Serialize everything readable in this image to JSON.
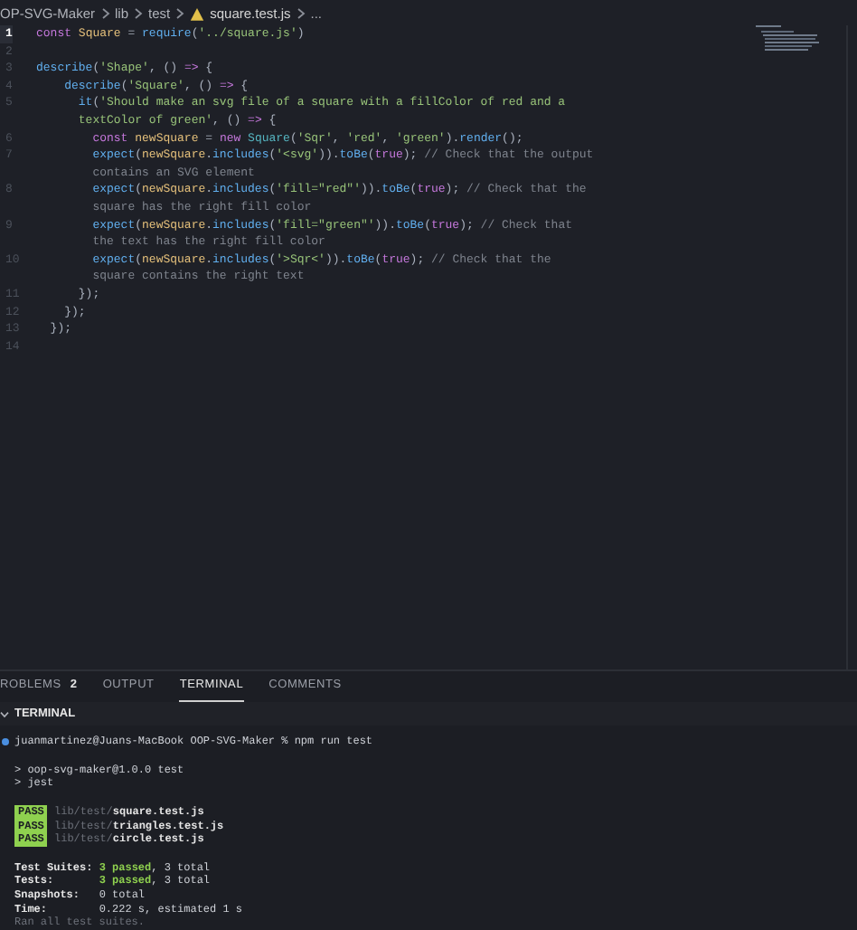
{
  "breadcrumb": [
    {
      "kind": "folder",
      "text": "OP-SVG-Maker"
    },
    {
      "kind": "folder",
      "text": "lib"
    },
    {
      "kind": "folder",
      "text": "test"
    },
    {
      "kind": "file",
      "text": "square.test.js"
    },
    {
      "kind": "more",
      "text": "..."
    }
  ],
  "code": [
    {
      "number": "1",
      "current": true,
      "tokens": [
        {
          "kind": "kw",
          "text": "const"
        },
        {
          "kind": "var",
          "text": " Square"
        },
        {
          "kind": "p",
          "text": " = "
        },
        {
          "kind": "fn",
          "text": "require"
        },
        {
          "kind": "p",
          "text": "("
        },
        {
          "kind": "str",
          "text": "'../square.js'"
        },
        {
          "kind": "p",
          "text": ")"
        }
      ]
    },
    {
      "number": "2",
      "current": false
    },
    {
      "number": "3",
      "current": false,
      "tokens": [
        {
          "kind": "fn",
          "text": "describe"
        },
        {
          "kind": "p",
          "text": "("
        },
        {
          "kind": "str",
          "text": "'Shape'"
        },
        {
          "kind": "p",
          "text": ", () "
        },
        {
          "kind": "kw",
          "text": "=>"
        },
        {
          "kind": "p",
          "text": " {"
        }
      ]
    },
    {
      "number": "4",
      "current": false,
      "tokens": [
        {
          "kind": "fn",
          "text": "    describe"
        },
        {
          "kind": "p",
          "text": "("
        },
        {
          "kind": "str",
          "text": "'Square'"
        },
        {
          "kind": "p",
          "text": ", () "
        },
        {
          "kind": "kw",
          "text": "=>"
        },
        {
          "kind": "p",
          "text": " {"
        }
      ]
    },
    {
      "number": "5",
      "current": false,
      "tokens": [
        {
          "kind": "fn",
          "text": "      it"
        },
        {
          "kind": "p",
          "text": "("
        },
        {
          "kind": "str",
          "text": "'Should make an svg file of a square with a fillColor of red and a"
        }
      ]
    },
    {
      "tokens": [
        {
          "kind": "str",
          "text": "      textColor of green'"
        },
        {
          "kind": "p",
          "text": ", () "
        },
        {
          "kind": "kw",
          "text": "=>"
        },
        {
          "kind": "p",
          "text": " {"
        }
      ]
    },
    {
      "number": "6",
      "current": false,
      "tokens": [
        {
          "kind": "kw",
          "text": "        const"
        },
        {
          "kind": "var",
          "text": " newSquare"
        },
        {
          "kind": "p",
          "text": " = "
        },
        {
          "kind": "kw",
          "text": "new"
        },
        {
          "kind": "cls",
          "text": " Square"
        },
        {
          "kind": "p",
          "text": "("
        },
        {
          "kind": "str",
          "text": "'Sqr'"
        },
        {
          "kind": "p",
          "text": ", "
        },
        {
          "kind": "str",
          "text": "'red'"
        },
        {
          "kind": "p",
          "text": ", "
        },
        {
          "kind": "str",
          "text": "'green'"
        },
        {
          "kind": "p",
          "text": ")."
        },
        {
          "kind": "fn",
          "text": "render"
        },
        {
          "kind": "p",
          "text": "();"
        }
      ]
    },
    {
      "number": "7",
      "current": false,
      "tokens": [
        {
          "kind": "fn",
          "text": "        expect"
        },
        {
          "kind": "p",
          "text": "("
        },
        {
          "kind": "var",
          "text": "newSquare"
        },
        {
          "kind": "p",
          "text": "."
        },
        {
          "kind": "fn",
          "text": "includes"
        },
        {
          "kind": "p",
          "text": "("
        },
        {
          "kind": "str",
          "text": "'<svg'"
        },
        {
          "kind": "p",
          "text": "))."
        },
        {
          "kind": "fn",
          "text": "toBe"
        },
        {
          "kind": "p",
          "text": "("
        },
        {
          "kind": "kw",
          "text": "true"
        },
        {
          "kind": "p",
          "text": "); "
        },
        {
          "kind": "com",
          "text": "// Check that the output"
        }
      ]
    },
    {
      "tokens": [
        {
          "kind": "com",
          "text": "        contains an SVG element"
        }
      ]
    },
    {
      "number": "8",
      "current": false,
      "tokens": [
        {
          "kind": "fn",
          "text": "        expect"
        },
        {
          "kind": "p",
          "text": "("
        },
        {
          "kind": "var",
          "text": "newSquare"
        },
        {
          "kind": "p",
          "text": "."
        },
        {
          "kind": "fn",
          "text": "includes"
        },
        {
          "kind": "p",
          "text": "("
        },
        {
          "kind": "str",
          "text": "'fill=\"red\"'"
        },
        {
          "kind": "p",
          "text": "))."
        },
        {
          "kind": "fn",
          "text": "toBe"
        },
        {
          "kind": "p",
          "text": "("
        },
        {
          "kind": "kw",
          "text": "true"
        },
        {
          "kind": "p",
          "text": "); "
        },
        {
          "kind": "com",
          "text": "// Check that the"
        }
      ]
    },
    {
      "tokens": [
        {
          "kind": "com",
          "text": "        square has the right fill color"
        }
      ]
    },
    {
      "number": "9",
      "current": false,
      "tokens": [
        {
          "kind": "fn",
          "text": "        expect"
        },
        {
          "kind": "p",
          "text": "("
        },
        {
          "kind": "var",
          "text": "newSquare"
        },
        {
          "kind": "p",
          "text": "."
        },
        {
          "kind": "fn",
          "text": "includes"
        },
        {
          "kind": "p",
          "text": "("
        },
        {
          "kind": "str",
          "text": "'fill=\"green\"'"
        },
        {
          "kind": "p",
          "text": "))."
        },
        {
          "kind": "fn",
          "text": "toBe"
        },
        {
          "kind": "p",
          "text": "("
        },
        {
          "kind": "kw",
          "text": "true"
        },
        {
          "kind": "p",
          "text": "); "
        },
        {
          "kind": "com",
          "text": "// Check that"
        }
      ]
    },
    {
      "tokens": [
        {
          "kind": "com",
          "text": "        the text has the right fill color"
        }
      ]
    },
    {
      "number": "10",
      "current": false,
      "tokens": [
        {
          "kind": "fn",
          "text": "        expect"
        },
        {
          "kind": "p",
          "text": "("
        },
        {
          "kind": "var",
          "text": "newSquare"
        },
        {
          "kind": "p",
          "text": "."
        },
        {
          "kind": "fn",
          "text": "includes"
        },
        {
          "kind": "p",
          "text": "("
        },
        {
          "kind": "str",
          "text": "'>Sqr<'"
        },
        {
          "kind": "p",
          "text": "))."
        },
        {
          "kind": "fn",
          "text": "toBe"
        },
        {
          "kind": "p",
          "text": "("
        },
        {
          "kind": "kw",
          "text": "true"
        },
        {
          "kind": "p",
          "text": "); "
        },
        {
          "kind": "com",
          "text": "// Check that the"
        }
      ]
    },
    {
      "tokens": [
        {
          "kind": "com",
          "text": "        square contains the right text"
        }
      ]
    },
    {
      "number": "11",
      "current": false,
      "tokens": [
        {
          "kind": "p",
          "text": "      });"
        }
      ]
    },
    {
      "number": "12",
      "current": false,
      "tokens": [
        {
          "kind": "p",
          "text": "    });"
        }
      ]
    },
    {
      "number": "13",
      "current": false,
      "tokens": [
        {
          "kind": "p",
          "text": "  });"
        }
      ]
    },
    {
      "number": "14",
      "current": false
    }
  ],
  "panel_tabs": [
    {
      "label": "ROBLEMS",
      "count": "2",
      "selected": false
    },
    {
      "label": "OUTPUT",
      "selected": false
    },
    {
      "label": "TERMINAL",
      "selected": true
    },
    {
      "label": "COMMENTS",
      "selected": false
    }
  ],
  "terminal_header": "TERMINAL",
  "terminal": [
    {
      "kind": "prompt",
      "tokens": [
        {
          "kind": "p",
          "text": "juanmartinez@Juans-MacBook OOP-SVG-Maker % npm run test"
        }
      ]
    },
    {
      "kind": "blank"
    },
    {
      "kind": "line",
      "tokens": [
        {
          "kind": "p",
          "text": "> oop-svg-maker@1.0.0 test"
        }
      ]
    },
    {
      "kind": "line",
      "tokens": [
        {
          "kind": "p",
          "text": "> jest"
        }
      ]
    },
    {
      "kind": "blank"
    },
    {
      "kind": "line",
      "tokens": [
        {
          "kind": "badge",
          "text": "PASS"
        },
        {
          "kind": "dim",
          "text": " lib/test/"
        },
        {
          "kind": "bold",
          "text": "square.test.js"
        }
      ]
    },
    {
      "kind": "line",
      "tokens": [
        {
          "kind": "badge",
          "text": "PASS"
        },
        {
          "kind": "dim",
          "text": " lib/test/"
        },
        {
          "kind": "bold",
          "text": "triangles.test.js"
        }
      ]
    },
    {
      "kind": "line",
      "tokens": [
        {
          "kind": "badge",
          "text": "PASS"
        },
        {
          "kind": "dim",
          "text": " lib/test/"
        },
        {
          "kind": "bold",
          "text": "circle.test.js"
        }
      ]
    },
    {
      "kind": "blank"
    },
    {
      "kind": "line",
      "tokens": [
        {
          "kind": "bold",
          "text": "Test Suites:"
        },
        {
          "kind": "good",
          "text": " 3 passed"
        },
        {
          "kind": "p",
          "text": ", 3 total"
        }
      ]
    },
    {
      "kind": "line",
      "tokens": [
        {
          "kind": "bold",
          "text": "Tests:"
        },
        {
          "kind": "good",
          "text": "       3 passed"
        },
        {
          "kind": "p",
          "text": ", 3 total"
        }
      ]
    },
    {
      "kind": "line",
      "tokens": [
        {
          "kind": "bold",
          "text": "Snapshots:"
        },
        {
          "kind": "p",
          "text": "   0 total"
        }
      ]
    },
    {
      "kind": "line",
      "tokens": [
        {
          "kind": "bold",
          "text": "Time:"
        },
        {
          "kind": "p",
          "text": "        0.222 s, estimated 1 s"
        }
      ]
    },
    {
      "kind": "line",
      "tokens": [
        {
          "kind": "dim",
          "text": "Ran all test suites."
        }
      ]
    }
  ]
}
